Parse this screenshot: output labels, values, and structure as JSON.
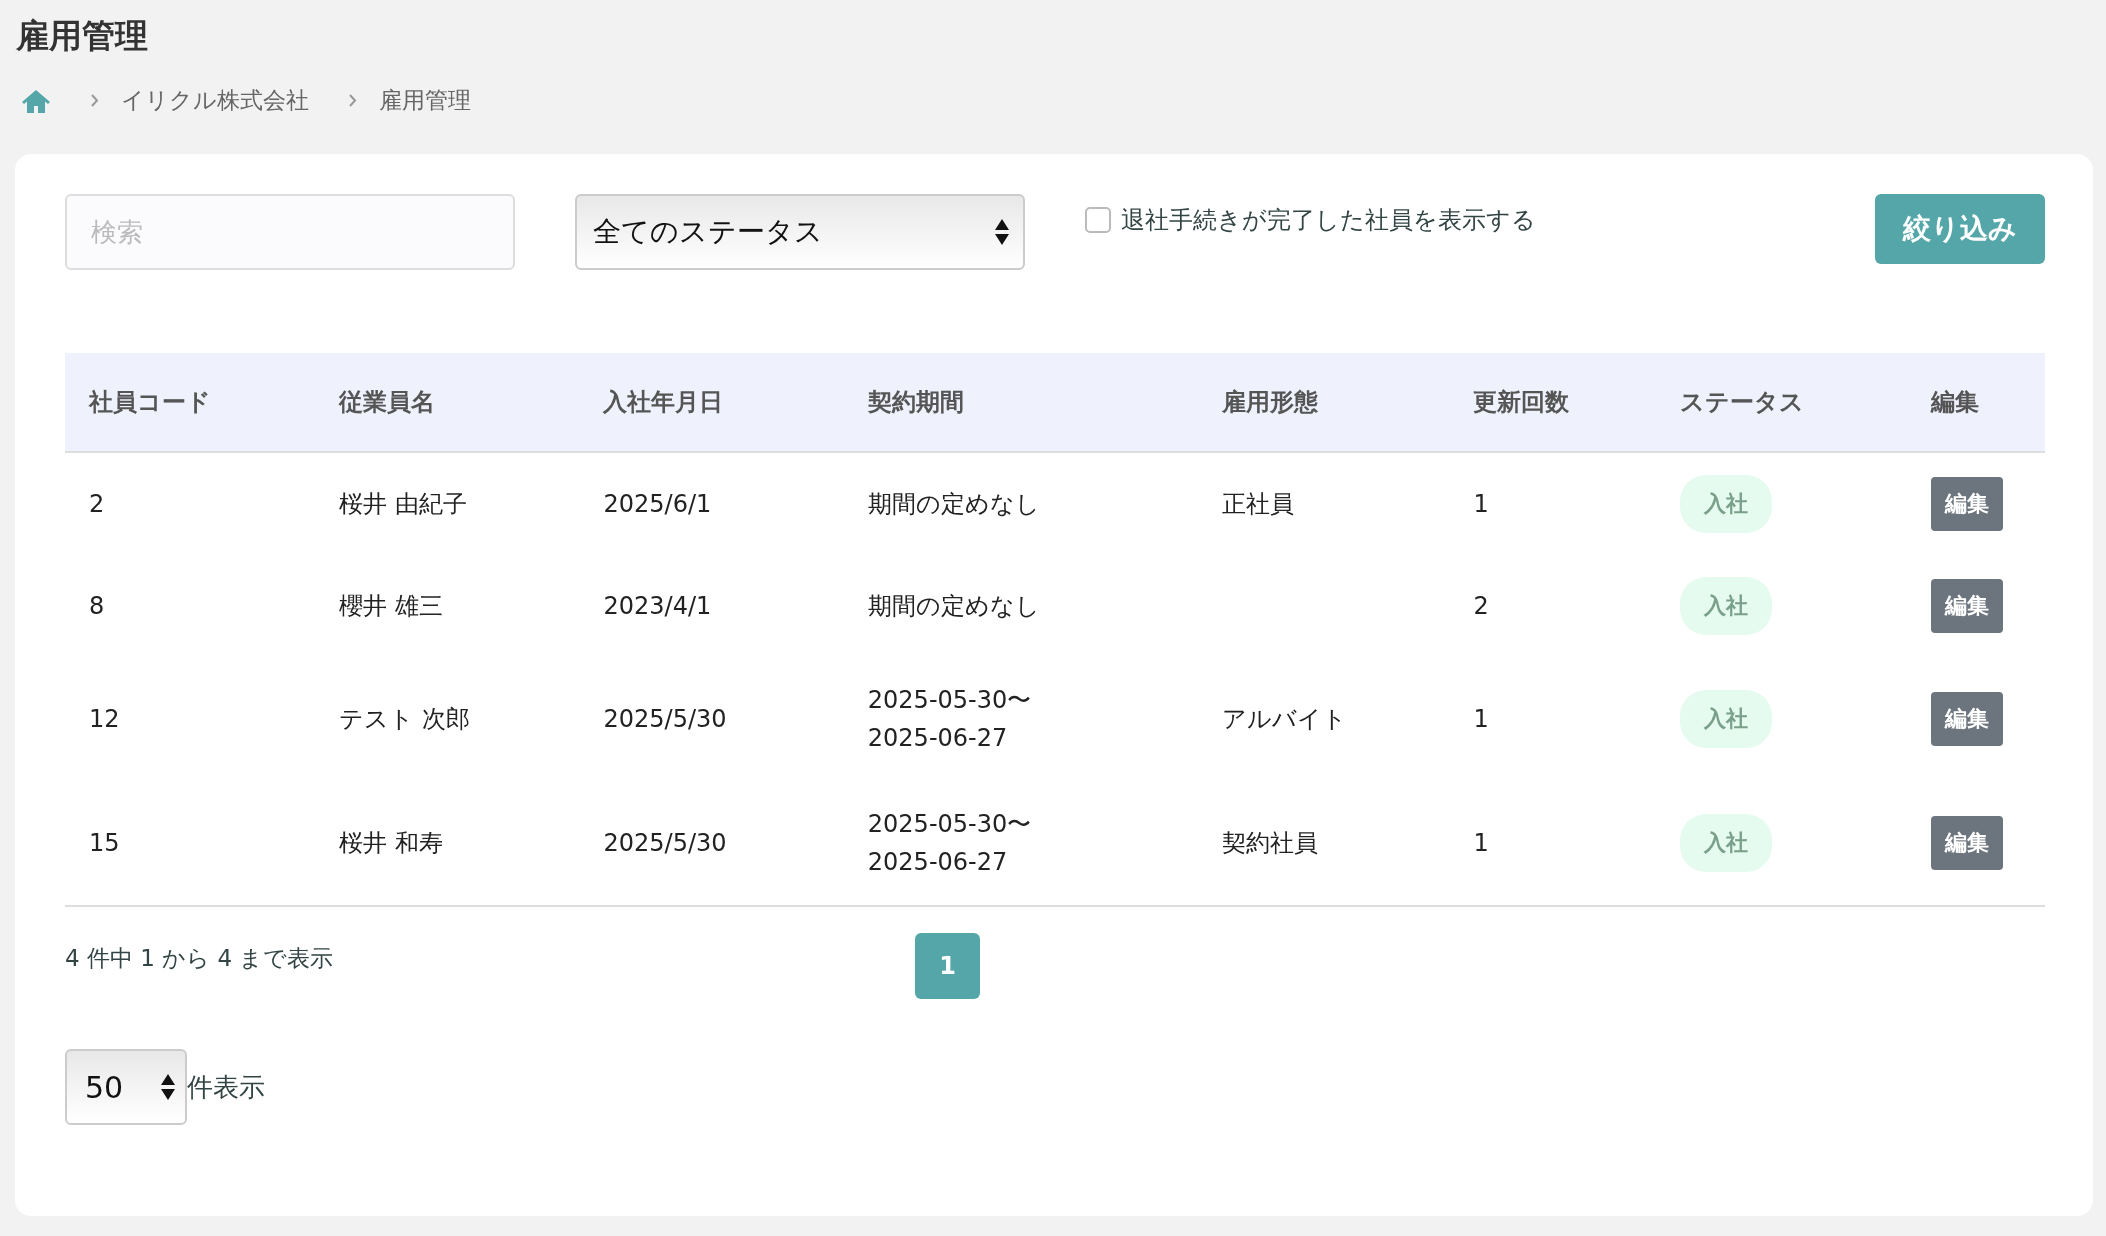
{
  "page_title": "雇用管理",
  "breadcrumb": [
    "イリクル株式会社",
    "雇用管理"
  ],
  "filters": {
    "search": {
      "placeholder": "検索"
    },
    "status_select": {
      "value": "全てのステータス"
    },
    "show_retired": {
      "label": "退社手続きが完了した社員を表示する",
      "checked": false
    },
    "filter_button": "絞り込み"
  },
  "table": {
    "columns": [
      "社員コード",
      "従業員名",
      "入社年月日",
      "契約期間",
      "雇用形態",
      "更新回数",
      "ステータス",
      "編集"
    ],
    "rows": [
      {
        "code": "2",
        "name": "桜井 由紀子",
        "hire_date": "2025/6/1",
        "contract_period": [
          "期間の定めなし"
        ],
        "employment_type": "正社員",
        "renewals": "1",
        "status": "入社",
        "edit": "編集"
      },
      {
        "code": "8",
        "name": "櫻井 雄三",
        "hire_date": "2023/4/1",
        "contract_period": [
          "期間の定めなし"
        ],
        "employment_type": "",
        "renewals": "2",
        "status": "入社",
        "edit": "編集"
      },
      {
        "code": "12",
        "name": "テスト 次郎",
        "hire_date": "2025/5/30",
        "contract_period": [
          "2025-05-30〜",
          "2025-06-27"
        ],
        "employment_type": "アルバイト",
        "renewals": "1",
        "status": "入社",
        "edit": "編集"
      },
      {
        "code": "15",
        "name": "桜井 和寿",
        "hire_date": "2025/5/30",
        "contract_period": [
          "2025-05-30〜",
          "2025-06-27"
        ],
        "employment_type": "契約社員",
        "renewals": "1",
        "status": "入社",
        "edit": "編集"
      }
    ]
  },
  "pagination": {
    "info": "4 件中 1 から 4 まで表示",
    "pages": [
      {
        "label": "1",
        "selected": true
      }
    ]
  },
  "page_size": {
    "value": "50",
    "label": "件表示"
  }
}
